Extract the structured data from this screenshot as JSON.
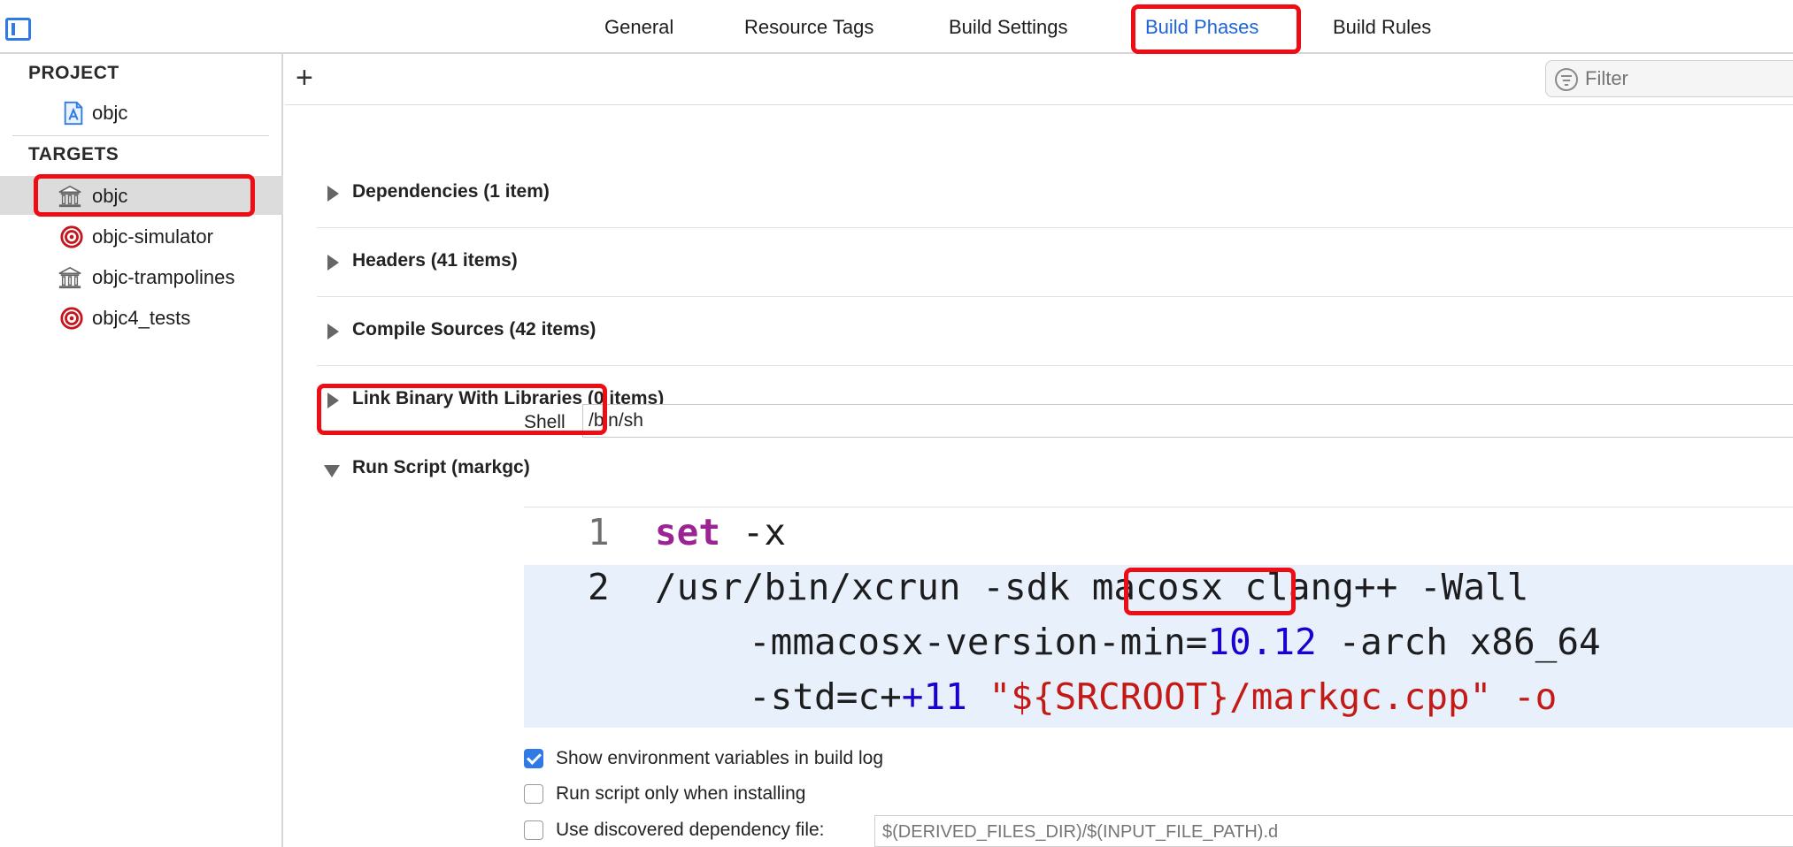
{
  "tabs": {
    "general": "General",
    "resource_tags": "Resource Tags",
    "build_settings": "Build Settings",
    "build_phases": "Build Phases",
    "build_rules": "Build Rules"
  },
  "sidebar": {
    "project_header": "PROJECT",
    "project_item": "objc",
    "targets_header": "TARGETS",
    "targets": [
      {
        "label": "objc",
        "icon": "library-icon",
        "selected": true
      },
      {
        "label": "objc-simulator",
        "icon": "target-icon"
      },
      {
        "label": "objc-trampolines",
        "icon": "library-icon"
      },
      {
        "label": "objc4_tests",
        "icon": "target-icon"
      }
    ]
  },
  "toolbar": {
    "add_label": "+",
    "filter_placeholder": "Filter"
  },
  "phases": {
    "dependencies": "Dependencies (1 item)",
    "headers": "Headers (41 items)",
    "compile_sources": "Compile Sources (42 items)",
    "link_binary": "Link Binary With Libraries (0 items)",
    "run_script": "Run Script (markgc)"
  },
  "run_script": {
    "shell_label": "Shell",
    "shell_value": "/bin/sh",
    "line_numbers": [
      "1",
      "2"
    ],
    "line1": {
      "kw": "set",
      "rest": " -x"
    },
    "line2": {
      "a": "/usr/bin/xcrun -sdk ",
      "sdk": "macosx",
      "b": " clang++ -Wall",
      "c": "-mmacosx-version-min=",
      "version": "10.12",
      "d": " -arch x86_64",
      "e": "-std=c+",
      "std": "+11",
      "f": " \"${SRCROOT}",
      "file": "/markgc.cpp",
      "g": "\" -o"
    },
    "options": {
      "show_env": "Show environment variables in build log",
      "only_installing": "Run script only when installing",
      "dep_file": "Use discovered dependency file:"
    },
    "dep_file_placeholder": "$(DERIVED_FILES_DIR)/$(INPUT_FILE_PATH).d"
  },
  "colors": {
    "accent": "#2f7ae5",
    "highlight": "#ee0d15"
  }
}
